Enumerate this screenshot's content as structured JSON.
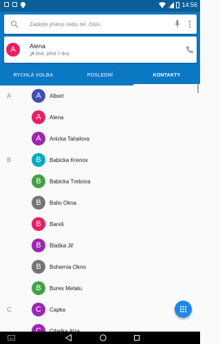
{
  "status_bar": {
    "time": "14:56"
  },
  "search": {
    "placeholder": "Zadejte jméno nebo tel. číslo."
  },
  "recent": {
    "avatar_letter": "A",
    "name": "Alena",
    "detail": "Jiné, před 7 dny",
    "avatar_color": "#e91e63"
  },
  "tabs": [
    {
      "label": "RYCHLÁ VOLBA"
    },
    {
      "label": "POSLEDNÍ"
    },
    {
      "label": "KONTAKTY"
    }
  ],
  "active_tab": "KONTAKTY",
  "contacts": [
    {
      "section": "A",
      "letter": "A",
      "name": "Albert",
      "color": "#3f51b5"
    },
    {
      "section": "",
      "letter": "A",
      "name": "Alena",
      "color": "#e91e63"
    },
    {
      "section": "",
      "letter": "A",
      "name": "Anicka Tahalova",
      "color": "#9c27b0"
    },
    {
      "section": "B",
      "letter": "B",
      "name": "Babicka Krenov",
      "color": "#00acc1"
    },
    {
      "section": "",
      "letter": "B",
      "name": "Babicka Trebova",
      "color": "#43a047"
    },
    {
      "section": "",
      "letter": "B",
      "name": "Balio Okna",
      "color": "#757575"
    },
    {
      "section": "",
      "letter": "B",
      "name": "Bareš",
      "color": "#e91e63"
    },
    {
      "section": "",
      "letter": "B",
      "name": "Blaška Jiř",
      "color": "#9c27b0"
    },
    {
      "section": "",
      "letter": "B",
      "name": "Bohemia Okno",
      "color": "#757575"
    },
    {
      "section": "",
      "letter": "B",
      "name": "Bures Metalu",
      "color": "#43a047"
    },
    {
      "section": "C",
      "letter": "C",
      "name": "Capka",
      "color": "#9c27b0"
    },
    {
      "section": "",
      "letter": "C",
      "name": "Cibelka Alza",
      "color": "#9c27b0"
    }
  ],
  "colors": {
    "status_bar": "#0a5f99",
    "header": "#0b78c4",
    "fab": "#1e88e5"
  },
  "icons": {
    "search": "search-icon",
    "mic": "mic-icon",
    "more": "more-vert-icon",
    "phone": "phone-icon",
    "call_arrow": "outgoing-call-arrow-icon",
    "fab": "dialpad-icon",
    "nav": [
      "keyboard-icon",
      "back-icon",
      "home-icon",
      "recent-apps-icon"
    ]
  }
}
